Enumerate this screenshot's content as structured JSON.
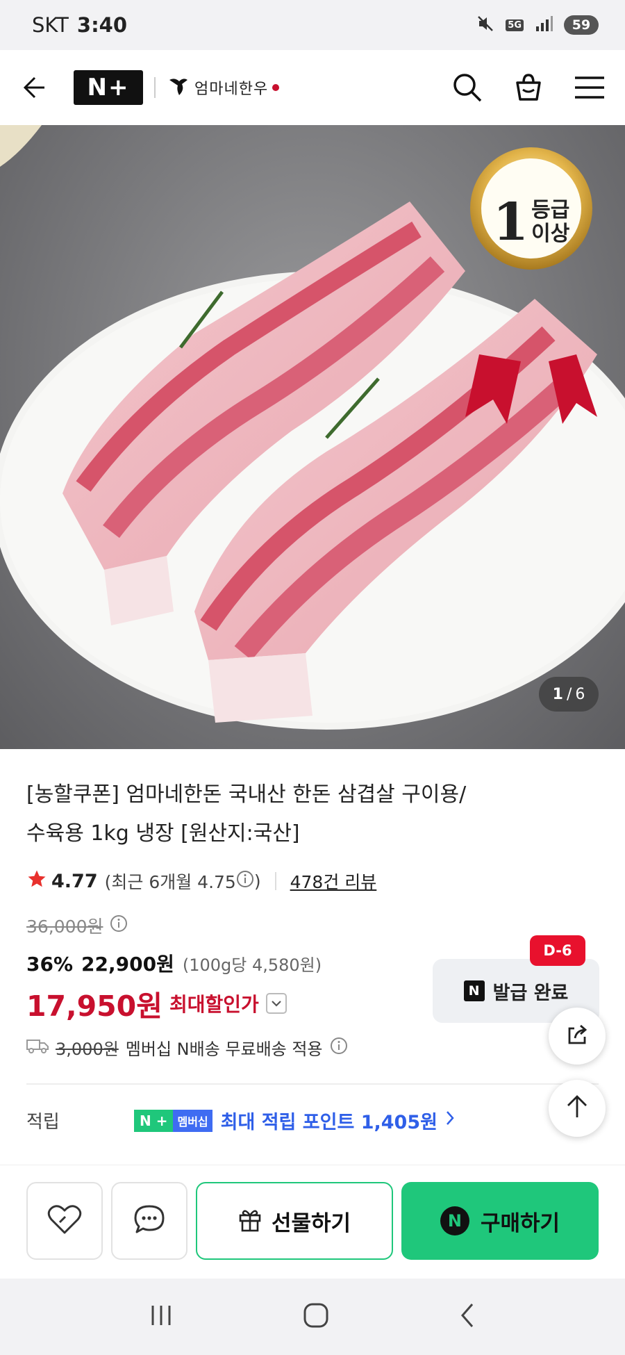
{
  "status": {
    "carrier": "SKT",
    "time": "3:40",
    "network": "5G",
    "battery": "59"
  },
  "header": {
    "logo": "N+",
    "brand": "엄마네한우"
  },
  "hero": {
    "badge_top": "1",
    "badge_line1": "등급",
    "badge_line2": "이상",
    "counter_current": "1",
    "counter_sep": "/",
    "counter_total": "6"
  },
  "product": {
    "title_line1": "[농할쿠폰] 엄마네한돈 국내산 한돈 삼겹살 구이용/",
    "title_line2": "수육용 1kg 냉장 [원산지:국산]",
    "rating": "4.77",
    "rating_recent": "(최근 6개월 4.75",
    "rating_recent_close": ")",
    "reviews": "478건 리뷰",
    "original_price": "36,000원",
    "discount": "36%",
    "sale_price": "22,900원",
    "unit_price": "(100g당 4,580원)",
    "max_price": "17,950원",
    "max_label": "최대할인가",
    "shipping_old": "3,000원",
    "shipping_text": "멤버십 N배송 무료배송 적용",
    "points_label": "적립",
    "points_badge_n": "N +",
    "points_badge_member": "멤버십",
    "points_text": "최대 적립 포인트 1,405원"
  },
  "coupon": {
    "dday": "D-6",
    "n": "N",
    "label": "발급 완료"
  },
  "actions": {
    "gift": "선물하기",
    "buy": "구매하기",
    "buy_n": "N"
  },
  "colors": {
    "naver_green": "#1fc77b",
    "sale_red": "#c8102e",
    "points_blue": "#2f5fe8"
  }
}
